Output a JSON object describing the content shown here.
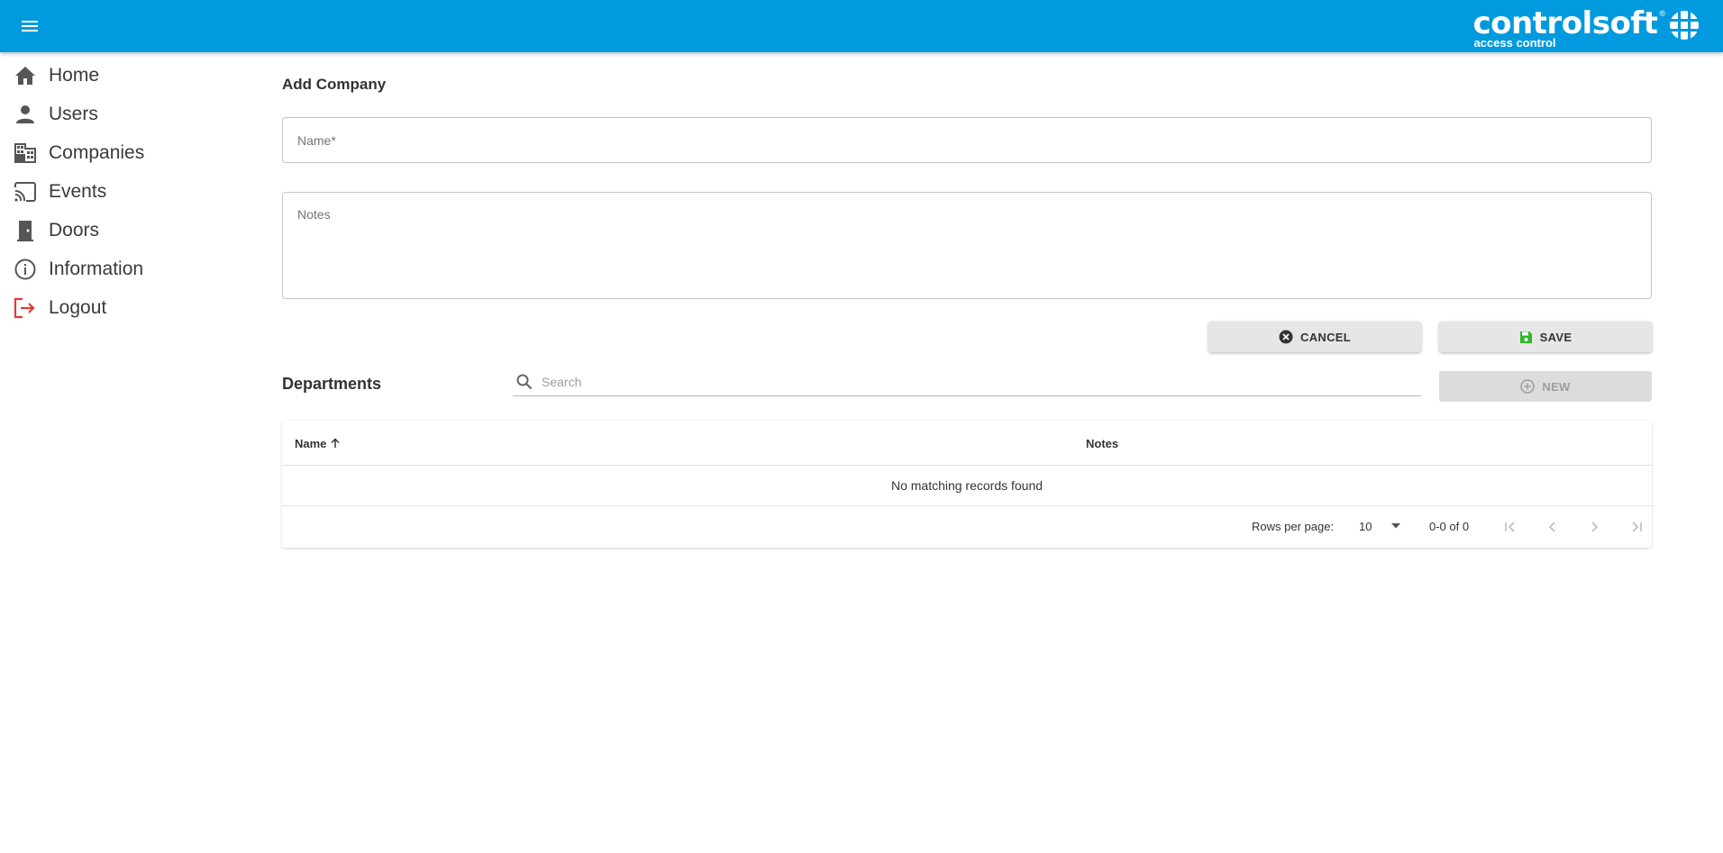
{
  "brand": {
    "name": "controlsoft",
    "tagline": "access control",
    "registered": "®",
    "color": "#029ade"
  },
  "header": {
    "menu_icon": "menu-icon"
  },
  "sidebar": {
    "items": [
      {
        "label": "Home",
        "icon": "home-icon"
      },
      {
        "label": "Users",
        "icon": "person-icon"
      },
      {
        "label": "Companies",
        "icon": "building-icon"
      },
      {
        "label": "Events",
        "icon": "cast-icon"
      },
      {
        "label": "Doors",
        "icon": "door-icon"
      },
      {
        "label": "Information",
        "icon": "info-icon"
      },
      {
        "label": "Logout",
        "icon": "logout-icon",
        "color": "#e53935"
      }
    ]
  },
  "form": {
    "title": "Add Company",
    "name_placeholder": "Name*",
    "name_value": "",
    "notes_placeholder": "Notes",
    "notes_value": "",
    "cancel_label": "CANCEL",
    "save_label": "SAVE",
    "save_icon_color": "#2eb82e"
  },
  "departments": {
    "title": "Departments",
    "search_placeholder": "Search",
    "search_value": "",
    "new_label": "NEW",
    "table": {
      "columns": [
        "Name",
        "Notes"
      ],
      "sort_column": "Name",
      "sort_direction": "ascending",
      "rows": [],
      "empty_message": "No matching records found"
    },
    "pagination": {
      "rows_per_page_label": "Rows per page:",
      "rows_per_page": "10",
      "range": "0-0 of 0"
    }
  }
}
